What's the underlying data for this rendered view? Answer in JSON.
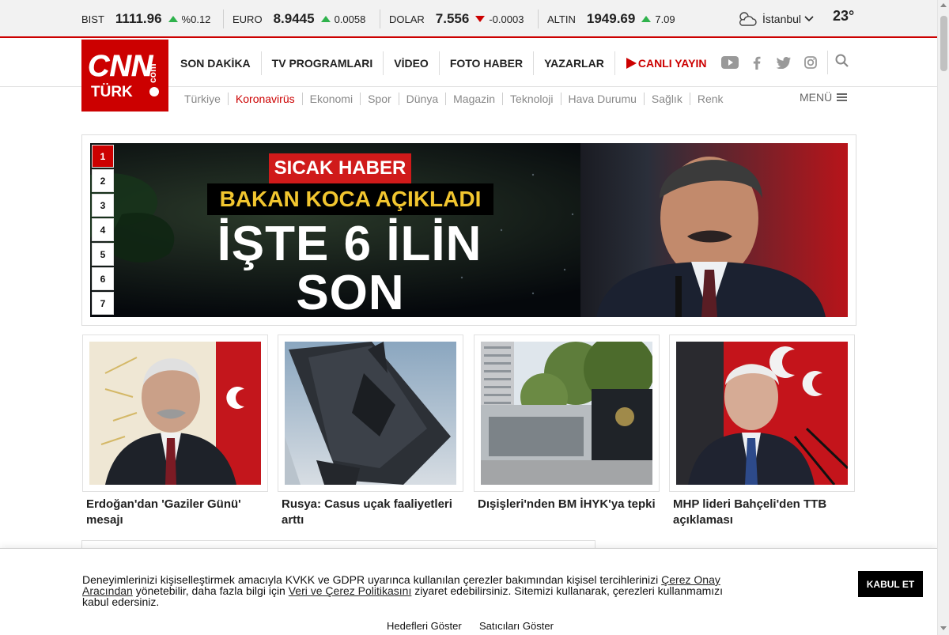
{
  "ticker": [
    {
      "symbol": "BIST",
      "value": "1111.96",
      "change": "%0.12",
      "direction": "up"
    },
    {
      "symbol": "EURO",
      "value": "8.9445",
      "change": "0.0058",
      "direction": "up"
    },
    {
      "symbol": "DOLAR",
      "value": "7.556",
      "change": "-0.0003",
      "direction": "down"
    },
    {
      "symbol": "ALTIN",
      "value": "1949.69",
      "change": "7.09",
      "direction": "up"
    }
  ],
  "weather": {
    "city": "İstanbul",
    "temperature": "23°",
    "icon": "partly-cloudy-icon"
  },
  "logo": {
    "cnn": "CNN",
    "turk": "TÜRK",
    "com": "com"
  },
  "nav": [
    "SON DAKİKA",
    "TV PROGRAMLARI",
    "VİDEO",
    "FOTO HABER",
    "YAZARLAR",
    "CANLI YAYIN"
  ],
  "social": [
    "youtube-icon",
    "facebook-icon",
    "twitter-icon",
    "instagram-icon"
  ],
  "subnav": [
    "Türkiye",
    "Koronavirüs",
    "Ekonomi",
    "Spor",
    "Dünya",
    "Magazin",
    "Teknoloji",
    "Hava Durumu",
    "Sağlık",
    "Renk"
  ],
  "subnav_active": "Koronavirüs",
  "menu_label": "MENÜ",
  "slider": {
    "numbers": [
      "1",
      "2",
      "3",
      "4",
      "5",
      "6",
      "7"
    ],
    "active": "1",
    "tag": "SICAK HABER",
    "subtitle": "BAKAN KOCA AÇIKLADI",
    "line1": "İŞTE 6 İLİN",
    "line2": "SON DURUMU"
  },
  "cards": [
    {
      "title": "Erdoğan'dan 'Gaziler Günü' mesajı"
    },
    {
      "title": "Rusya: Casus uçak faaliyetleri arttı"
    },
    {
      "title": "Dışişleri'nden BM İHYK'ya tepki"
    },
    {
      "title": "MHP lideri Bahçeli'den TTB açıklaması"
    }
  ],
  "cookie": {
    "text_1": "Deneyimlerinizi kişiselleştirmek amacıyla KVKK ve GDPR uyarınca kullanılan çerezler bakımından kişisel tercihlerinizi ",
    "link_1": "Çerez Onay Aracından",
    "text_2": " yönetebilir, daha fazla bilgi için ",
    "link_2": "Veri ve Çerez Politikasını",
    "text_3": " ziyaret edebilirsiniz. Sitemizi kullanarak, çerezleri kullanmamızı kabul edersiniz.",
    "accept": "KABUL ET",
    "show_purposes": "Hedefleri Göster",
    "show_vendors": "Satıcıları Göster"
  },
  "colors": {
    "brand_red": "#cc0000",
    "up_green": "#2fb24c",
    "headline_yellow": "#f2c62f"
  }
}
